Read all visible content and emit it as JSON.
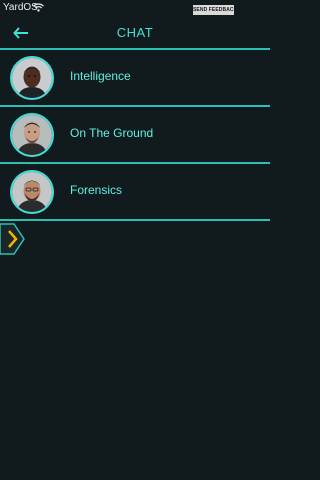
{
  "status_bar": {
    "carrier": "YardOS",
    "feedback_label": "SEND FEEDBACK"
  },
  "header": {
    "title": "CHAT",
    "back_icon": "back-arrow-icon"
  },
  "chats": [
    {
      "label": "Intelligence"
    },
    {
      "label": "On The Ground"
    },
    {
      "label": "Forensics"
    }
  ],
  "next_icon": "chevron-right-icon",
  "colors": {
    "accent": "#3fe0d8",
    "background": "#111a1c",
    "divider": "#2bbfb6",
    "chevron": "#f0b400"
  }
}
